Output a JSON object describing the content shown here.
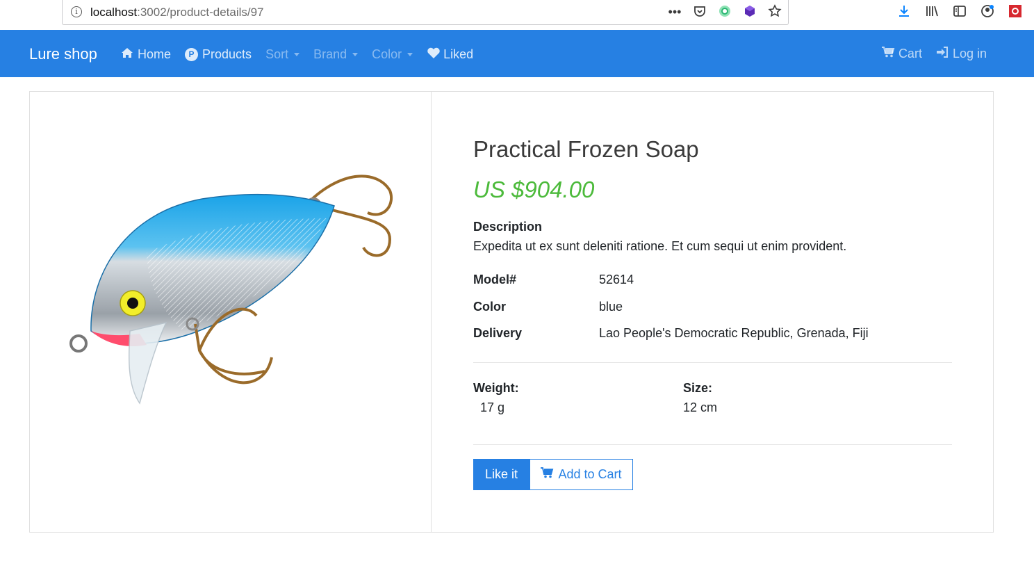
{
  "browser": {
    "url_host": "localhost",
    "url_path": ":3002/product-details/97"
  },
  "navbar": {
    "brand": "Lure shop",
    "items": [
      {
        "label": "Home",
        "icon": "home-icon"
      },
      {
        "label": "Products",
        "icon": "products-p-icon"
      },
      {
        "label": "Sort",
        "dropdown": true
      },
      {
        "label": "Brand",
        "dropdown": true
      },
      {
        "label": "Color",
        "dropdown": true
      },
      {
        "label": "Liked",
        "icon": "heart-icon"
      }
    ],
    "right": [
      {
        "label": "Cart",
        "icon": "cart-icon"
      },
      {
        "label": "Log in",
        "icon": "sign-in-icon"
      }
    ],
    "color": "#2680e3"
  },
  "product": {
    "title": "Practical Frozen Soap",
    "price": "US $904.00",
    "price_color": "#4cba3b",
    "description_label": "Description",
    "description": "Expedita ut ex sunt deleniti ratione. Et cum sequi ut enim provident.",
    "specs": [
      {
        "key": "Model#",
        "value": "52614"
      },
      {
        "key": "Color",
        "value": "blue"
      },
      {
        "key": "Delivery",
        "value": "Lao People's Democratic Republic, Grenada, Fiji"
      }
    ],
    "weight_label": "Weight:",
    "weight": "17 g",
    "size_label": "Size:",
    "size": "12 cm",
    "like_button": "Like it",
    "cart_button": "Add to Cart"
  }
}
